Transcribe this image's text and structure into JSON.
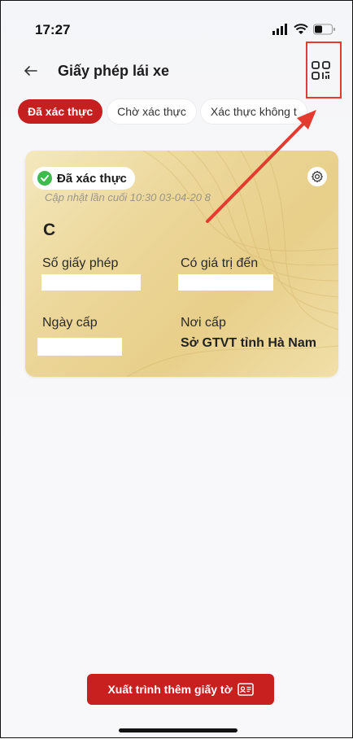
{
  "status_bar": {
    "time": "17:27"
  },
  "header": {
    "title": "Giấy phép lái xe"
  },
  "tabs": [
    {
      "label": "Đã xác thực",
      "active": true
    },
    {
      "label": "Chờ xác thực",
      "active": false
    },
    {
      "label": "Xác thực không t",
      "active": false
    }
  ],
  "card": {
    "badge": "Đã xác thực",
    "updated": "Cập nhật lần cuối 10:30 03-04-20 8",
    "license_class": "C",
    "license_number_label": "Số giấy phép",
    "valid_until_label": "Có giá trị đến",
    "issue_date_label": "Ngày cấp",
    "issue_place_label": "Nơi cấp",
    "issue_place_value": "Sở GTVT tỉnh Hà Nam"
  },
  "bottom": {
    "present_button": "Xuất trình thêm giấy tờ"
  },
  "colors": {
    "primary": "#c61f1f",
    "verified": "#3dbb4d",
    "annotation": "#e43a2f"
  },
  "icons": [
    "back-arrow-icon",
    "qr-code-icon",
    "check-icon",
    "settings-gear-icon",
    "id-card-icon"
  ]
}
